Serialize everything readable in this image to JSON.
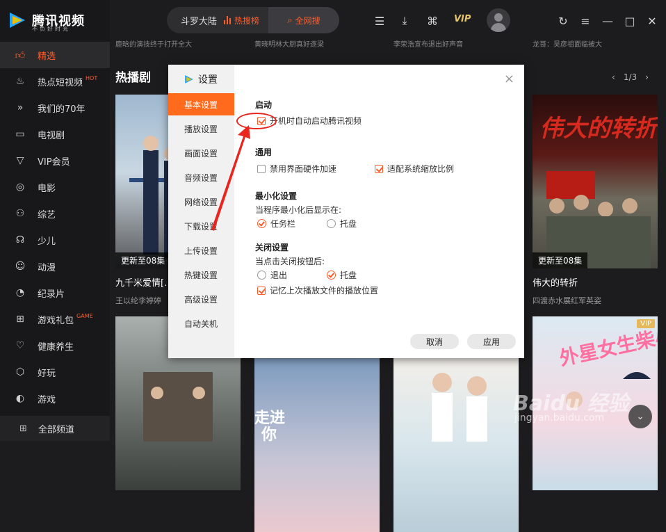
{
  "app": {
    "title": "腾讯视频",
    "slogan": "不负好时光"
  },
  "sidebar": {
    "items": [
      {
        "label": "精选",
        "icon": "thumbs-up-icon",
        "badge": ""
      },
      {
        "label": "热点短视频",
        "icon": "flame-icon",
        "badge": "HOT"
      },
      {
        "label": "我们的70年",
        "icon": "double-chevron-icon",
        "badge": ""
      },
      {
        "label": "电视剧",
        "icon": "tv-icon",
        "badge": ""
      },
      {
        "label": "VIP会员",
        "icon": "vip-diamond-icon",
        "badge": ""
      },
      {
        "label": "电影",
        "icon": "film-reel-icon",
        "badge": ""
      },
      {
        "label": "综艺",
        "icon": "variety-icon",
        "badge": ""
      },
      {
        "label": "少儿",
        "icon": "kids-icon",
        "badge": ""
      },
      {
        "label": "动漫",
        "icon": "anime-icon",
        "badge": ""
      },
      {
        "label": "纪录片",
        "icon": "documentary-icon",
        "badge": ""
      },
      {
        "label": "游戏礼包",
        "icon": "gamepad-icon",
        "badge": "GAME"
      },
      {
        "label": "健康养生",
        "icon": "heart-icon",
        "badge": ""
      },
      {
        "label": "好玩",
        "icon": "fun-icon",
        "badge": ""
      },
      {
        "label": "游戏",
        "icon": "controller-icon",
        "badge": ""
      }
    ],
    "all_channels": "全部频道"
  },
  "topbar": {
    "search_query": "斗罗大陆",
    "hot_label": "热搜榜",
    "search_button": "全网搜",
    "vip_label": "VIP"
  },
  "main": {
    "section_title": "热播剧",
    "pager": {
      "current": "1/3",
      "prev": "‹",
      "next": "›"
    },
    "subtitles": [
      "鹿晗的演技终于打开全大",
      "黄晓明林大厨真好逐梁",
      "李荣浩宣布退出好声音",
      "龙哥：吴彦祖面临被大"
    ],
    "cards": [
      {
        "update": "更新至08集",
        "name": "九千米爱情[…]",
        "desc": "王以纶李婷婷"
      },
      {
        "update": "",
        "name": "",
        "desc": ""
      },
      {
        "update": "",
        "name": "",
        "desc": ""
      },
      {
        "update": "更新至08集",
        "name": "伟大的转折",
        "desc": "四渡赤水展红军英姿"
      },
      {
        "update": "",
        "name": "",
        "desc": ""
      },
      {
        "update": "",
        "name": "",
        "desc": ""
      },
      {
        "update": "",
        "name": "",
        "desc": ""
      },
      {
        "update": "",
        "name": "",
        "desc": "",
        "vip": "VIP"
      }
    ],
    "bottom_texts": {
      "card6_title": "走进",
      "card6_sub": "你"
    }
  },
  "dialog": {
    "title": "设置",
    "close": "×",
    "menu": [
      "基本设置",
      "播放设置",
      "画面设置",
      "音频设置",
      "网络设置",
      "下载设置",
      "上传设置",
      "热键设置",
      "高级设置",
      "自动关机"
    ],
    "active_menu": "基本设置",
    "startup": {
      "title": "启动",
      "auto_start": "开机时自动启动腾讯视频",
      "auto_start_checked": true
    },
    "general": {
      "title": "通用",
      "disable_hw": "禁用界面硬件加速",
      "disable_hw_checked": false,
      "scale": "适配系统缩放比例",
      "scale_checked": true
    },
    "minimize": {
      "title": "最小化设置",
      "desc": "当程序最小化后显示在:",
      "taskbar": "任务栏",
      "tray": "托盘",
      "selected": "任务栏"
    },
    "close_setting": {
      "title": "关闭设置",
      "desc": "当点击关闭按钮后:",
      "exit": "退出",
      "tray": "托盘",
      "selected": "托盘",
      "remember": "记忆上次播放文件的播放位置",
      "remember_checked": true
    },
    "cancel": "取消",
    "apply": "应用"
  },
  "watermark": {
    "main": "Baidu 经验",
    "sub": "jingyan.baidu.com"
  },
  "colors": {
    "accent": "#ff5c2a",
    "dialog_active": "#ff6a1c",
    "annotation_red": "#e8251f",
    "sidebar_bg": "#18181a"
  }
}
